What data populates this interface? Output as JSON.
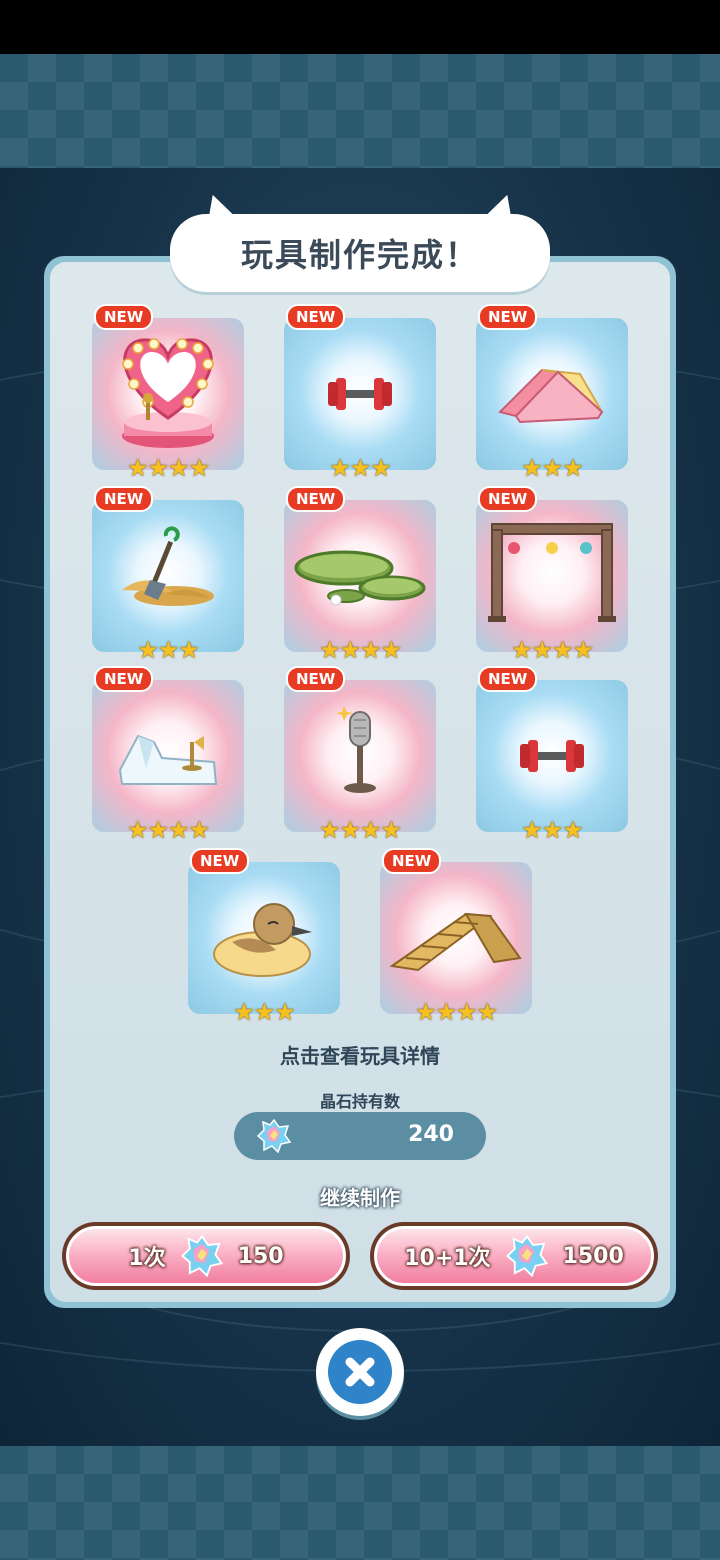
{
  "title": "玩具制作完成！",
  "cards": [
    {
      "name": "heart-stage",
      "badge": "NEW",
      "stars": "★★★★",
      "rarity": 4,
      "glow": "pink"
    },
    {
      "name": "red-dumbbell",
      "badge": "NEW",
      "stars": "★★★",
      "rarity": 3,
      "glow": "blue"
    },
    {
      "name": "pink-slide",
      "badge": "NEW",
      "stars": "★★★",
      "rarity": 3,
      "glow": "blue"
    },
    {
      "name": "sand-shovel",
      "badge": "NEW",
      "stars": "★★★",
      "rarity": 3,
      "glow": "blue"
    },
    {
      "name": "lily-pads",
      "badge": "NEW",
      "stars": "★★★★",
      "rarity": 4,
      "glow": "pink"
    },
    {
      "name": "stage-truss",
      "badge": "NEW",
      "stars": "★★★★",
      "rarity": 4,
      "glow": "pink"
    },
    {
      "name": "iceberg-mic",
      "badge": "NEW",
      "stars": "★★★★",
      "rarity": 4,
      "glow": "pink"
    },
    {
      "name": "microphone",
      "badge": "NEW",
      "stars": "★★★★",
      "rarity": 4,
      "glow": "pink"
    },
    {
      "name": "red-dumbbell-2",
      "badge": "NEW",
      "stars": "★★★",
      "rarity": 3,
      "glow": "blue"
    },
    {
      "name": "duck",
      "badge": "NEW",
      "stars": "★★★",
      "rarity": 3,
      "glow": "blue"
    },
    {
      "name": "wooden-ramp",
      "badge": "NEW",
      "stars": "★★★★",
      "rarity": 4,
      "glow": "pink"
    }
  ],
  "detail_hint": "点击查看玩具详情",
  "owned_label": "晶石持有数",
  "owned_value": "240",
  "continue_label": "继续制作",
  "buttons": [
    {
      "label": "1次",
      "cost": "150"
    },
    {
      "label": "10+1次",
      "cost": "1500"
    }
  ],
  "icons": {
    "crystal": "rainbow-crystal-icon",
    "close": "close-icon"
  }
}
